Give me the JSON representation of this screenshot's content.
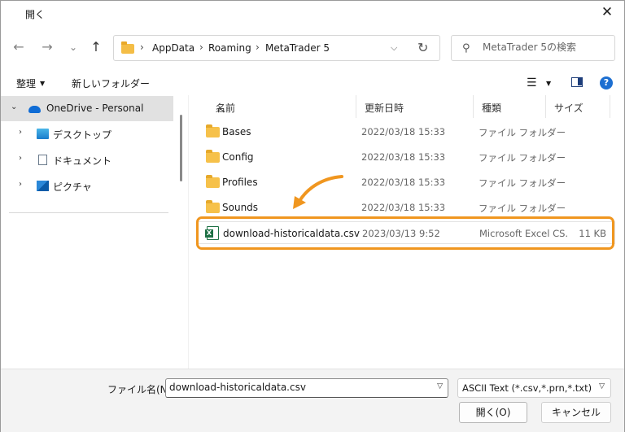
{
  "window": {
    "title": "開く",
    "close_glyph": "✕"
  },
  "nav": {
    "back": "←",
    "forward": "→",
    "recent": "⌄",
    "up": "↑",
    "breadcrumb": [
      "AppData",
      "Roaming",
      "MetaTrader 5"
    ],
    "sep": "›",
    "refresh": "↻",
    "search_placeholder": "MetaTrader 5の検索"
  },
  "toolbar": {
    "organize": "整理",
    "new_folder": "新しいフォルダー"
  },
  "sidebar": {
    "items": [
      {
        "label": "OneDrive - Personal",
        "icon": "cloud-icon"
      },
      {
        "label": "デスクトップ",
        "icon": "desktop-icon"
      },
      {
        "label": "ドキュメント",
        "icon": "documents-icon"
      },
      {
        "label": "ピクチャ",
        "icon": "pictures-icon"
      }
    ]
  },
  "columns": {
    "name": "名前",
    "date": "更新日時",
    "type": "種類",
    "size": "サイズ"
  },
  "files": [
    {
      "name": "Bases",
      "date": "2022/03/18 15:33",
      "type": "ファイル フォルダー",
      "size": "",
      "icon": "folder-icon"
    },
    {
      "name": "Config",
      "date": "2022/03/18 15:33",
      "type": "ファイル フォルダー",
      "size": "",
      "icon": "folder-icon"
    },
    {
      "name": "Profiles",
      "date": "2022/03/18 15:33",
      "type": "ファイル フォルダー",
      "size": "",
      "icon": "folder-icon"
    },
    {
      "name": "Sounds",
      "date": "2022/03/18 15:33",
      "type": "ファイル フォルダー",
      "size": "",
      "icon": "folder-icon"
    },
    {
      "name": "download-historicaldata.csv",
      "date": "2023/03/13 9:52",
      "type": "Microsoft Excel CS...",
      "size": "11 KB",
      "icon": "excel-file-icon"
    }
  ],
  "footer": {
    "filename_label": "ファイル名(N):",
    "filename_value": "download-historicaldata.csv",
    "filetype": "ASCII Text (*.csv,*.prn,*.txt)",
    "open": "開く(O)",
    "cancel": "キャンセル"
  },
  "colors": {
    "highlight": "#f0961f",
    "accent": "#1d6fd1"
  }
}
